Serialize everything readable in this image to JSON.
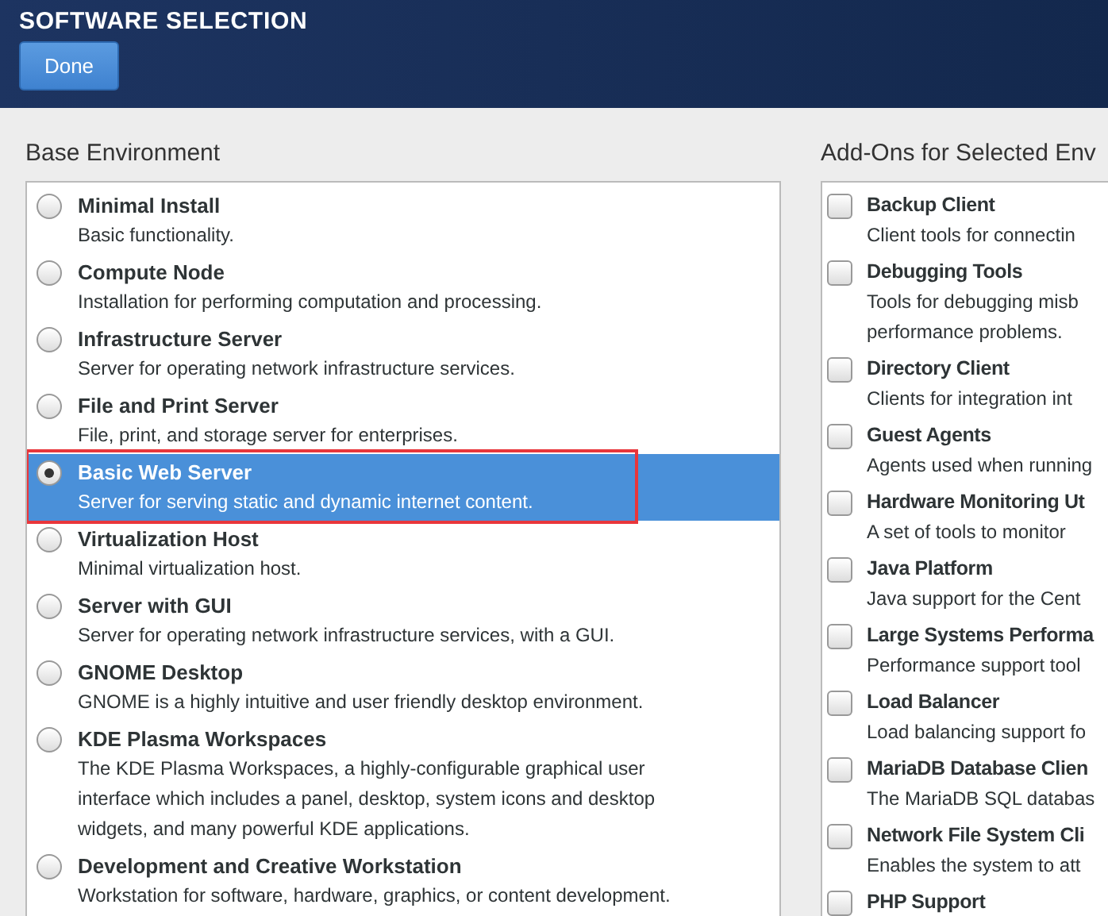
{
  "header": {
    "title": "SOFTWARE SELECTION",
    "done_button": "Done"
  },
  "base_environment": {
    "heading": "Base Environment",
    "items": [
      {
        "title": "Minimal Install",
        "description": [
          "Basic functionality."
        ],
        "selected": false,
        "annotated": false
      },
      {
        "title": "Compute Node",
        "description": [
          "Installation for performing computation and processing."
        ],
        "selected": false,
        "annotated": false
      },
      {
        "title": "Infrastructure Server",
        "description": [
          "Server for operating network infrastructure services."
        ],
        "selected": false,
        "annotated": false
      },
      {
        "title": "File and Print Server",
        "description": [
          "File, print, and storage server for enterprises."
        ],
        "selected": false,
        "annotated": false
      },
      {
        "title": "Basic Web Server",
        "description": [
          "Server for serving static and dynamic internet content."
        ],
        "selected": true,
        "annotated": true
      },
      {
        "title": "Virtualization Host",
        "description": [
          "Minimal virtualization host."
        ],
        "selected": false,
        "annotated": false
      },
      {
        "title": "Server with GUI",
        "description": [
          "Server for operating network infrastructure services, with a GUI."
        ],
        "selected": false,
        "annotated": false
      },
      {
        "title": "GNOME Desktop",
        "description": [
          "GNOME is a highly intuitive and user friendly desktop environment."
        ],
        "selected": false,
        "annotated": false
      },
      {
        "title": "KDE Plasma Workspaces",
        "description": [
          "The KDE Plasma Workspaces, a highly-configurable graphical user",
          "interface which includes a panel, desktop, system icons and desktop",
          "widgets, and many powerful KDE applications."
        ],
        "selected": false,
        "annotated": false
      },
      {
        "title": "Development and Creative Workstation",
        "description": [
          "Workstation for software, hardware, graphics, or content development."
        ],
        "selected": false,
        "annotated": false
      }
    ]
  },
  "add_ons": {
    "heading": "Add-Ons for Selected Env",
    "items": [
      {
        "title": "Backup Client",
        "description": [
          "Client tools for connectin"
        ],
        "checked": false
      },
      {
        "title": "Debugging Tools",
        "description": [
          "Tools for debugging misb",
          "performance problems."
        ],
        "checked": false
      },
      {
        "title": "Directory Client",
        "description": [
          "Clients for integration int"
        ],
        "checked": false
      },
      {
        "title": "Guest Agents",
        "description": [
          "Agents used when running"
        ],
        "checked": false
      },
      {
        "title": "Hardware Monitoring Ut",
        "description": [
          "A set of tools to monitor"
        ],
        "checked": false
      },
      {
        "title": "Java Platform",
        "description": [
          "Java support for the Cent"
        ],
        "checked": false
      },
      {
        "title": "Large Systems Performa",
        "description": [
          "Performance support tool"
        ],
        "checked": false
      },
      {
        "title": "Load Balancer",
        "description": [
          "Load balancing support fo"
        ],
        "checked": false
      },
      {
        "title": "MariaDB Database Clien",
        "description": [
          "The MariaDB SQL databas"
        ],
        "checked": false
      },
      {
        "title": "Network File System Cli",
        "description": [
          "Enables the system to att"
        ],
        "checked": false
      },
      {
        "title": "PHP Support",
        "checked": false
      }
    ]
  }
}
